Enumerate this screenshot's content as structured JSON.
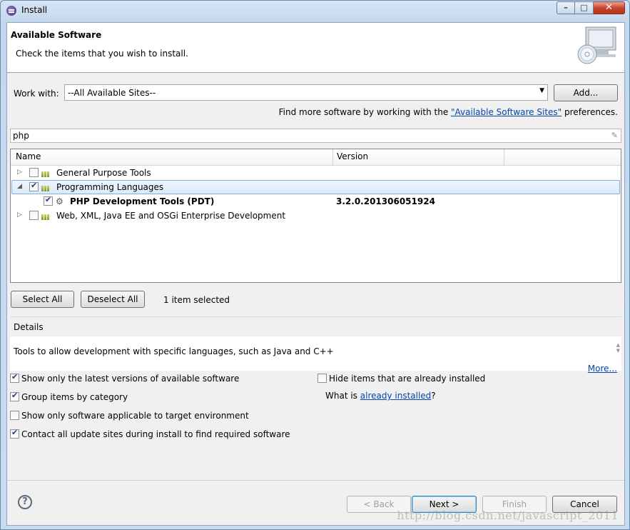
{
  "window": {
    "title": "Install"
  },
  "banner": {
    "title": "Available Software",
    "subtitle": "Check the items that you wish to install."
  },
  "work_with": {
    "label": "Work with:",
    "value": "--All Available Sites--",
    "add_button": "Add...",
    "hint_prefix": "Find more software by working with the ",
    "hint_link": "\"Available Software Sites\"",
    "hint_suffix": " preferences."
  },
  "filter": {
    "value": "php"
  },
  "tree": {
    "columns": [
      "Name",
      "Version"
    ],
    "rows": [
      {
        "label": "General Purpose Tools",
        "version": "",
        "checked": false,
        "expanded": false
      },
      {
        "label": "Programming Languages",
        "version": "",
        "checked": true,
        "expanded": true
      },
      {
        "label": "PHP Development Tools (PDT)",
        "version": "3.2.0.201306051924",
        "checked": true,
        "child": true
      },
      {
        "label": "Web, XML, Java EE and OSGi Enterprise Development",
        "version": "",
        "checked": false,
        "expanded": false
      }
    ]
  },
  "selection": {
    "select_all": "Select All",
    "deselect_all": "Deselect All",
    "status": "1 item selected"
  },
  "details": {
    "label": "Details",
    "text": "Tools to allow development with specific languages, such as Java and C++",
    "more": "More..."
  },
  "options": {
    "latest_versions": "Show only the latest versions of available software",
    "group_by_category": "Group items by category",
    "applicable_only": "Show only software applicable to target environment",
    "contact_sites": "Contact all update sites during install to find required software",
    "hide_installed": "Hide items that are already installed",
    "what_is_prefix": "What is ",
    "what_is_link": "already installed",
    "what_is_suffix": "?"
  },
  "buttons": {
    "back": "< Back",
    "next": "Next >",
    "finish": "Finish",
    "cancel": "Cancel"
  },
  "watermark": "http://blog.csdn.net/javascript_2011"
}
